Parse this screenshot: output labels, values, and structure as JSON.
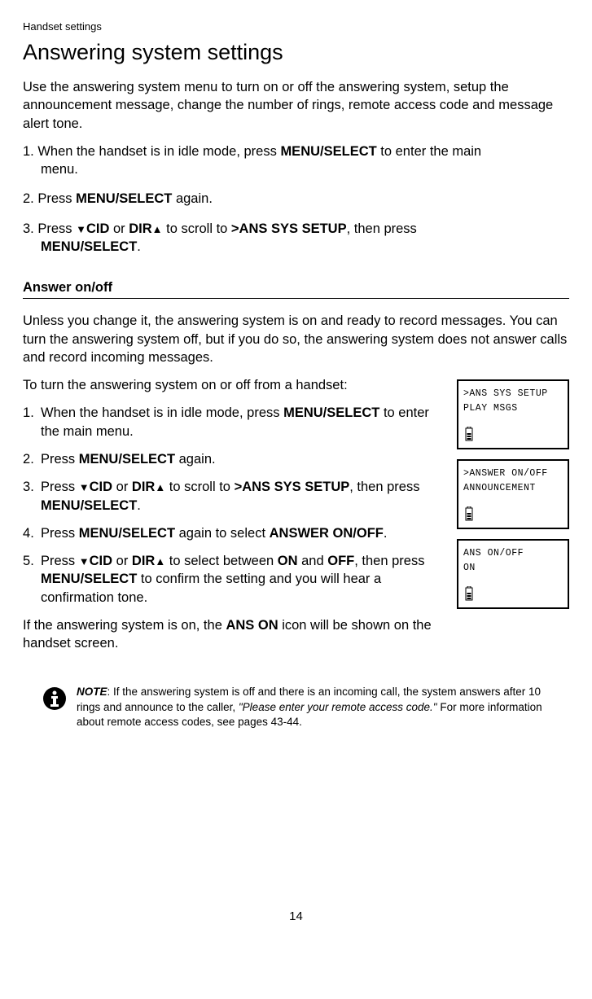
{
  "header": "Handset settings",
  "title": "Answering system settings",
  "intro": "Use the answering system menu to turn on or off the answering system, setup the announcement message, change the number of rings, remote access code and message alert tone.",
  "steps1": {
    "s1a": "1. When the handset is in idle mode, press ",
    "s1b": "MENU/",
    "s1c": "SELECT",
    "s1d": " to enter the main",
    "s1e": "menu.",
    "s2a": "2. Press ",
    "s2b": "MENU/",
    "s2c": "SELECT",
    "s2d": " again.",
    "s3a": "3. Press ",
    "s3b": "CID",
    "s3c": " or ",
    "s3d": "DIR",
    "s3e": " to scroll to ",
    "s3f": ">ANS SYS SETUP",
    "s3g": ", then press",
    "s3h": "MENU",
    "s3i": "/SELECT",
    "s3j": "."
  },
  "section2_title": "Answer on/off",
  "section2_intro": "Unless you change it, the answering system is on and ready to record messages. You can turn the answering system off, but if you do so, the answering system does not answer calls and record incoming messages.",
  "section2_lead": "To turn the answering system on or off from a handset:",
  "steps2": {
    "li1a": "When the handset is in idle mode, press ",
    "li1b": "MENU/",
    "li1c": "SELECT",
    "li1d": " to enter the main menu.",
    "li2a": "Press ",
    "li2b": "MENU",
    "li2c": "/SELECT",
    "li2d": " again.",
    "li3a": "Press ",
    "li3b": "CID",
    "li3c": " or ",
    "li3d": "DIR",
    "li3e": " to scroll to ",
    "li3f": ">ANS SYS SETUP",
    "li3g": ", then press ",
    "li3h": "MENU",
    "li3i": "/SELECT",
    "li3j": ".",
    "li4a": "Press ",
    "li4b": "MENU",
    "li4c": "/SELECT",
    "li4d": " again to select ",
    "li4e": "ANSWER ON/OFF",
    "li4f": ".",
    "li5a": "Press ",
    "li5b": "CID",
    "li5c": " or ",
    "li5d": "DIR",
    "li5e": " to select between ",
    "li5f": "ON",
    "li5g": " and ",
    "li5h": "OFF",
    "li5i": ", then press ",
    "li5j": "MENU",
    "li5k": "/SELECT",
    "li5l": " to confirm the setting and you will hear a confirmation tone."
  },
  "closing_a": "If the answering system is on, the ",
  "closing_b": "ANS ON",
  "closing_c": " icon will be shown on the handset screen.",
  "lcd": {
    "b1l1": ">ANS SYS SETUP",
    "b1l2": " PLAY MSGS",
    "b2l1": ">ANSWER ON/OFF",
    "b2l2": " ANNOUNCEMENT",
    "b3l1": "ANS ON/OFF",
    "b3l2": "ON"
  },
  "note": {
    "label": "NOTE",
    "t1": ": If the answering system is off and there is an incoming call, the system answers after 10 rings and announce to the caller, ",
    "quote": "\"Please enter your remote access code.\"",
    "t2": " For more information about remote access codes, see pages 43-44."
  },
  "page_number": "14"
}
